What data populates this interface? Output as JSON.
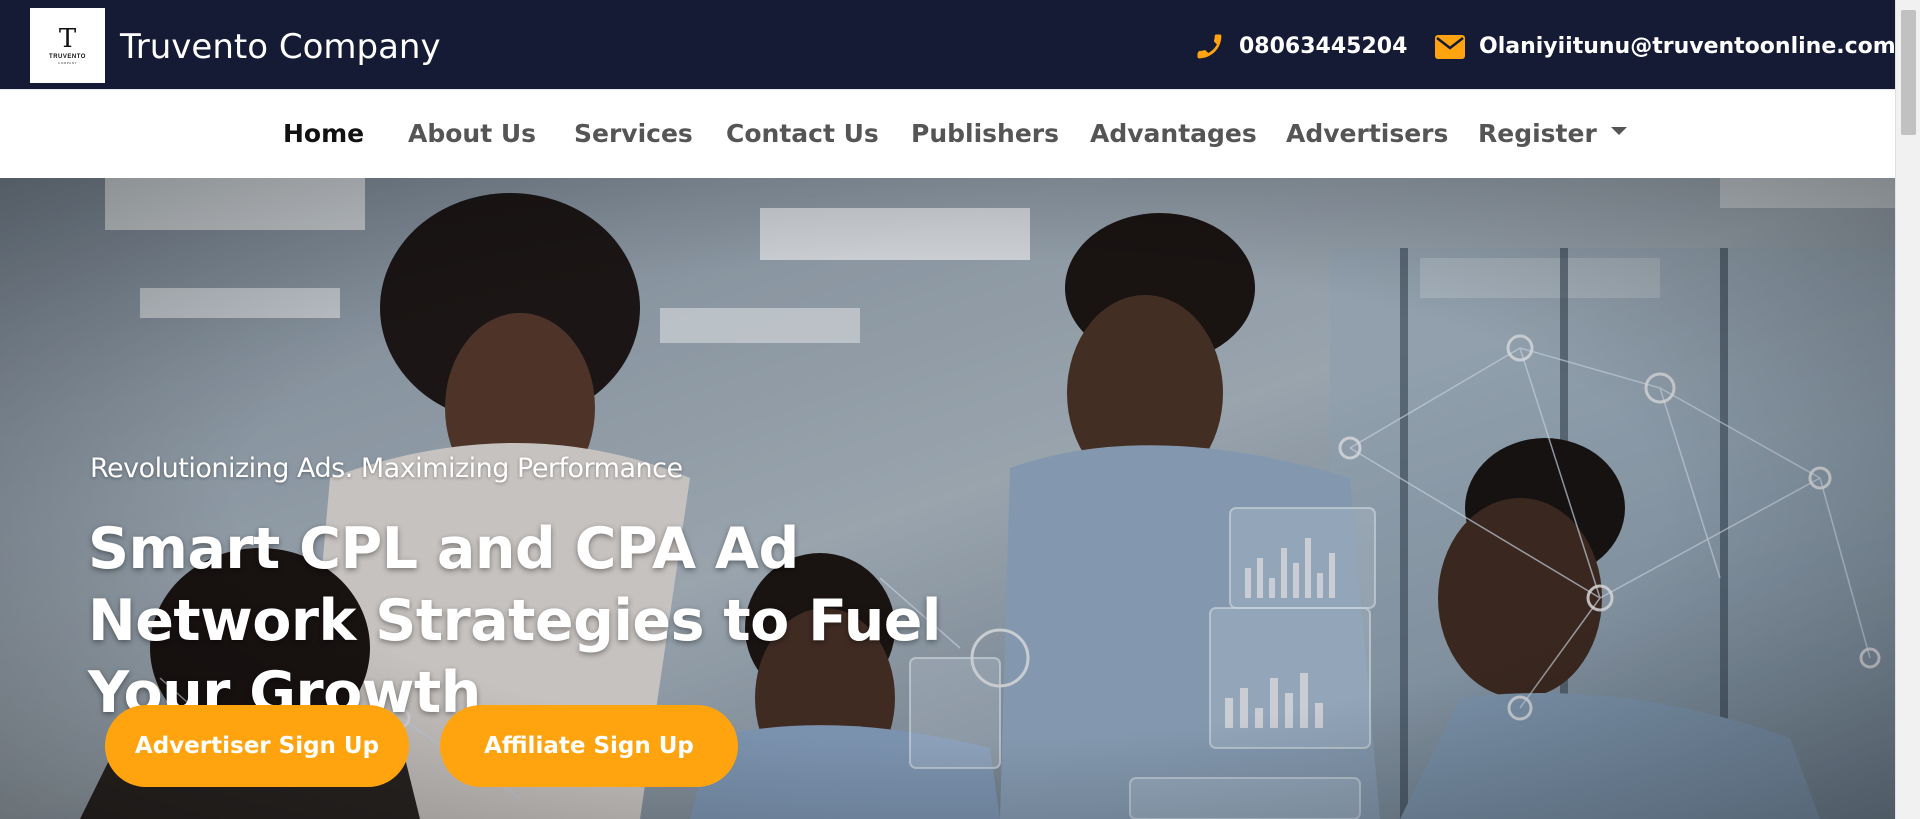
{
  "header": {
    "logo_letter": "T",
    "logo_name": "TRUVENTO",
    "logo_sub": "COMPANY",
    "brand": "Truvento Company",
    "phone": "08063445204",
    "email": "Olaniyiitunu@truventoonline.com",
    "icon_color": "#ffa40f"
  },
  "nav": {
    "items": [
      {
        "label": "Home",
        "icon": null
      },
      {
        "label": "About Us"
      },
      {
        "label": "Services"
      },
      {
        "label": "Contact Us"
      },
      {
        "label": "Publishers"
      },
      {
        "label": "Advantages"
      },
      {
        "label": "Advertisers"
      },
      {
        "label": "Register",
        "icon": "caret-down-icon"
      }
    ],
    "active": "Home"
  },
  "hero": {
    "tagline": "Revolutionizing Ads. Maximizing Performance",
    "title": "Smart CPL and CPA Ad Network Strategies to Fuel Your Growth",
    "advertiser_button": "Advertiser Sign Up",
    "affiliate_button": "Affiliate Sign Up",
    "button_color": "#ffa40f"
  },
  "colors": {
    "topbar": "#161b35",
    "accent": "#ffa40f"
  }
}
